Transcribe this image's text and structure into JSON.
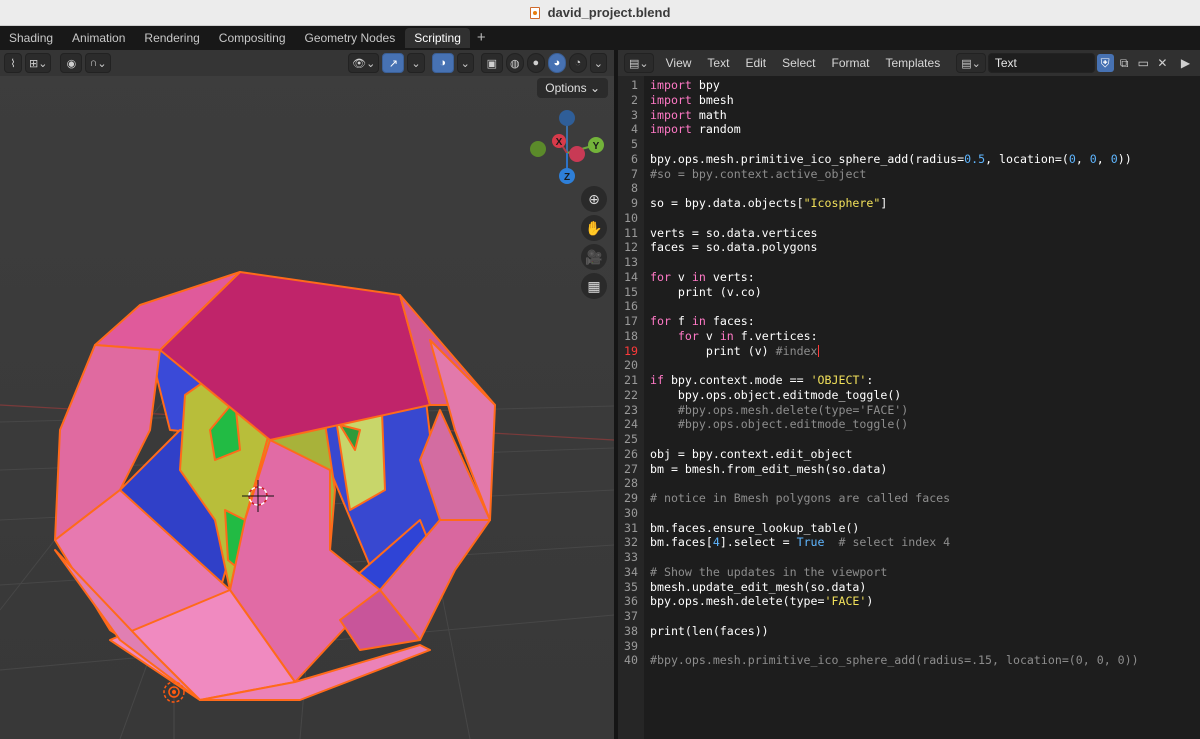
{
  "window": {
    "title": "david_project.blend"
  },
  "workspace_tabs": [
    "Shading",
    "Animation",
    "Rendering",
    "Compositing",
    "Geometry Nodes",
    "Scripting"
  ],
  "active_tab": "Scripting",
  "add_tab_label": "+",
  "viewport": {
    "options_label": "Options ⌄",
    "gizmo_axes": {
      "x": "X",
      "y": "Y",
      "z": "Z"
    }
  },
  "editor": {
    "menus": [
      "View",
      "Text",
      "Edit",
      "Select",
      "Format",
      "Templates"
    ],
    "text_name": "Text",
    "current_line": 19
  },
  "code_lines": [
    [
      [
        "kw",
        "import"
      ],
      [
        "pl",
        " bpy"
      ]
    ],
    [
      [
        "kw",
        "import"
      ],
      [
        "pl",
        " bmesh"
      ]
    ],
    [
      [
        "kw",
        "import"
      ],
      [
        "pl",
        " math"
      ]
    ],
    [
      [
        "kw",
        "import"
      ],
      [
        "pl",
        " random"
      ]
    ],
    [],
    [
      [
        "pl",
        "bpy.ops.mesh.primitive_ico_sphere_add(radius="
      ],
      [
        "nm",
        "0.5"
      ],
      [
        "pl",
        ", location=("
      ],
      [
        "nm",
        "0"
      ],
      [
        "pl",
        ", "
      ],
      [
        "nm",
        "0"
      ],
      [
        "pl",
        ", "
      ],
      [
        "nm",
        "0"
      ],
      [
        "pl",
        "))"
      ]
    ],
    [
      [
        "cm",
        "#so = bpy.context.active_object"
      ]
    ],
    [],
    [
      [
        "pl",
        "so = bpy.data.objects["
      ],
      [
        "st",
        "\"Icosphere\""
      ],
      [
        "pl",
        "]"
      ]
    ],
    [],
    [
      [
        "pl",
        "verts = so.data.vertices"
      ]
    ],
    [
      [
        "pl",
        "faces = so.data.polygons"
      ]
    ],
    [],
    [
      [
        "kw",
        "for"
      ],
      [
        "pl",
        " v "
      ],
      [
        "kw",
        "in"
      ],
      [
        "pl",
        " verts:"
      ]
    ],
    [
      [
        "pl",
        "    print (v.co)"
      ]
    ],
    [],
    [
      [
        "kw",
        "for"
      ],
      [
        "pl",
        " f "
      ],
      [
        "kw",
        "in"
      ],
      [
        "pl",
        " faces:"
      ]
    ],
    [
      [
        "pl",
        "    "
      ],
      [
        "kw",
        "for"
      ],
      [
        "pl",
        " v "
      ],
      [
        "kw",
        "in"
      ],
      [
        "pl",
        " f.vertices:"
      ]
    ],
    [
      [
        "pl",
        "        print (v) "
      ],
      [
        "cm",
        "#index"
      ]
    ],
    [],
    [
      [
        "kw",
        "if"
      ],
      [
        "pl",
        " bpy.context.mode == "
      ],
      [
        "st",
        "'OBJECT'"
      ],
      [
        "pl",
        ":"
      ]
    ],
    [
      [
        "pl",
        "    bpy.ops.object.editmode_toggle()"
      ]
    ],
    [
      [
        "pl",
        "    "
      ],
      [
        "cm",
        "#bpy.ops.mesh.delete(type='FACE')"
      ]
    ],
    [
      [
        "pl",
        "    "
      ],
      [
        "cm",
        "#bpy.ops.object.editmode_toggle()"
      ]
    ],
    [],
    [
      [
        "pl",
        "obj = bpy.context.edit_object"
      ]
    ],
    [
      [
        "pl",
        "bm = bmesh.from_edit_mesh(so.data)"
      ]
    ],
    [],
    [
      [
        "cm",
        "# notice in Bmesh polygons are called faces"
      ]
    ],
    [],
    [
      [
        "pl",
        "bm.faces.ensure_lookup_table()"
      ]
    ],
    [
      [
        "pl",
        "bm.faces["
      ],
      [
        "nm",
        "4"
      ],
      [
        "pl",
        "].select = "
      ],
      [
        "nm",
        "True"
      ],
      [
        "pl",
        "  "
      ],
      [
        "cm",
        "# select index 4"
      ]
    ],
    [],
    [
      [
        "cm",
        "# Show the updates in the viewport"
      ]
    ],
    [
      [
        "pl",
        "bmesh.update_edit_mesh(so.data)"
      ]
    ],
    [
      [
        "pl",
        "bpy.ops.mesh.delete(type="
      ],
      [
        "st",
        "'FACE'"
      ],
      [
        "pl",
        ")"
      ]
    ],
    [],
    [
      [
        "pl",
        "print(len(faces))"
      ]
    ],
    [],
    [
      [
        "cm",
        "#bpy.ops.mesh.primitive_ico_sphere_add(radius=.15, location=(0, 0, 0))"
      ]
    ]
  ]
}
